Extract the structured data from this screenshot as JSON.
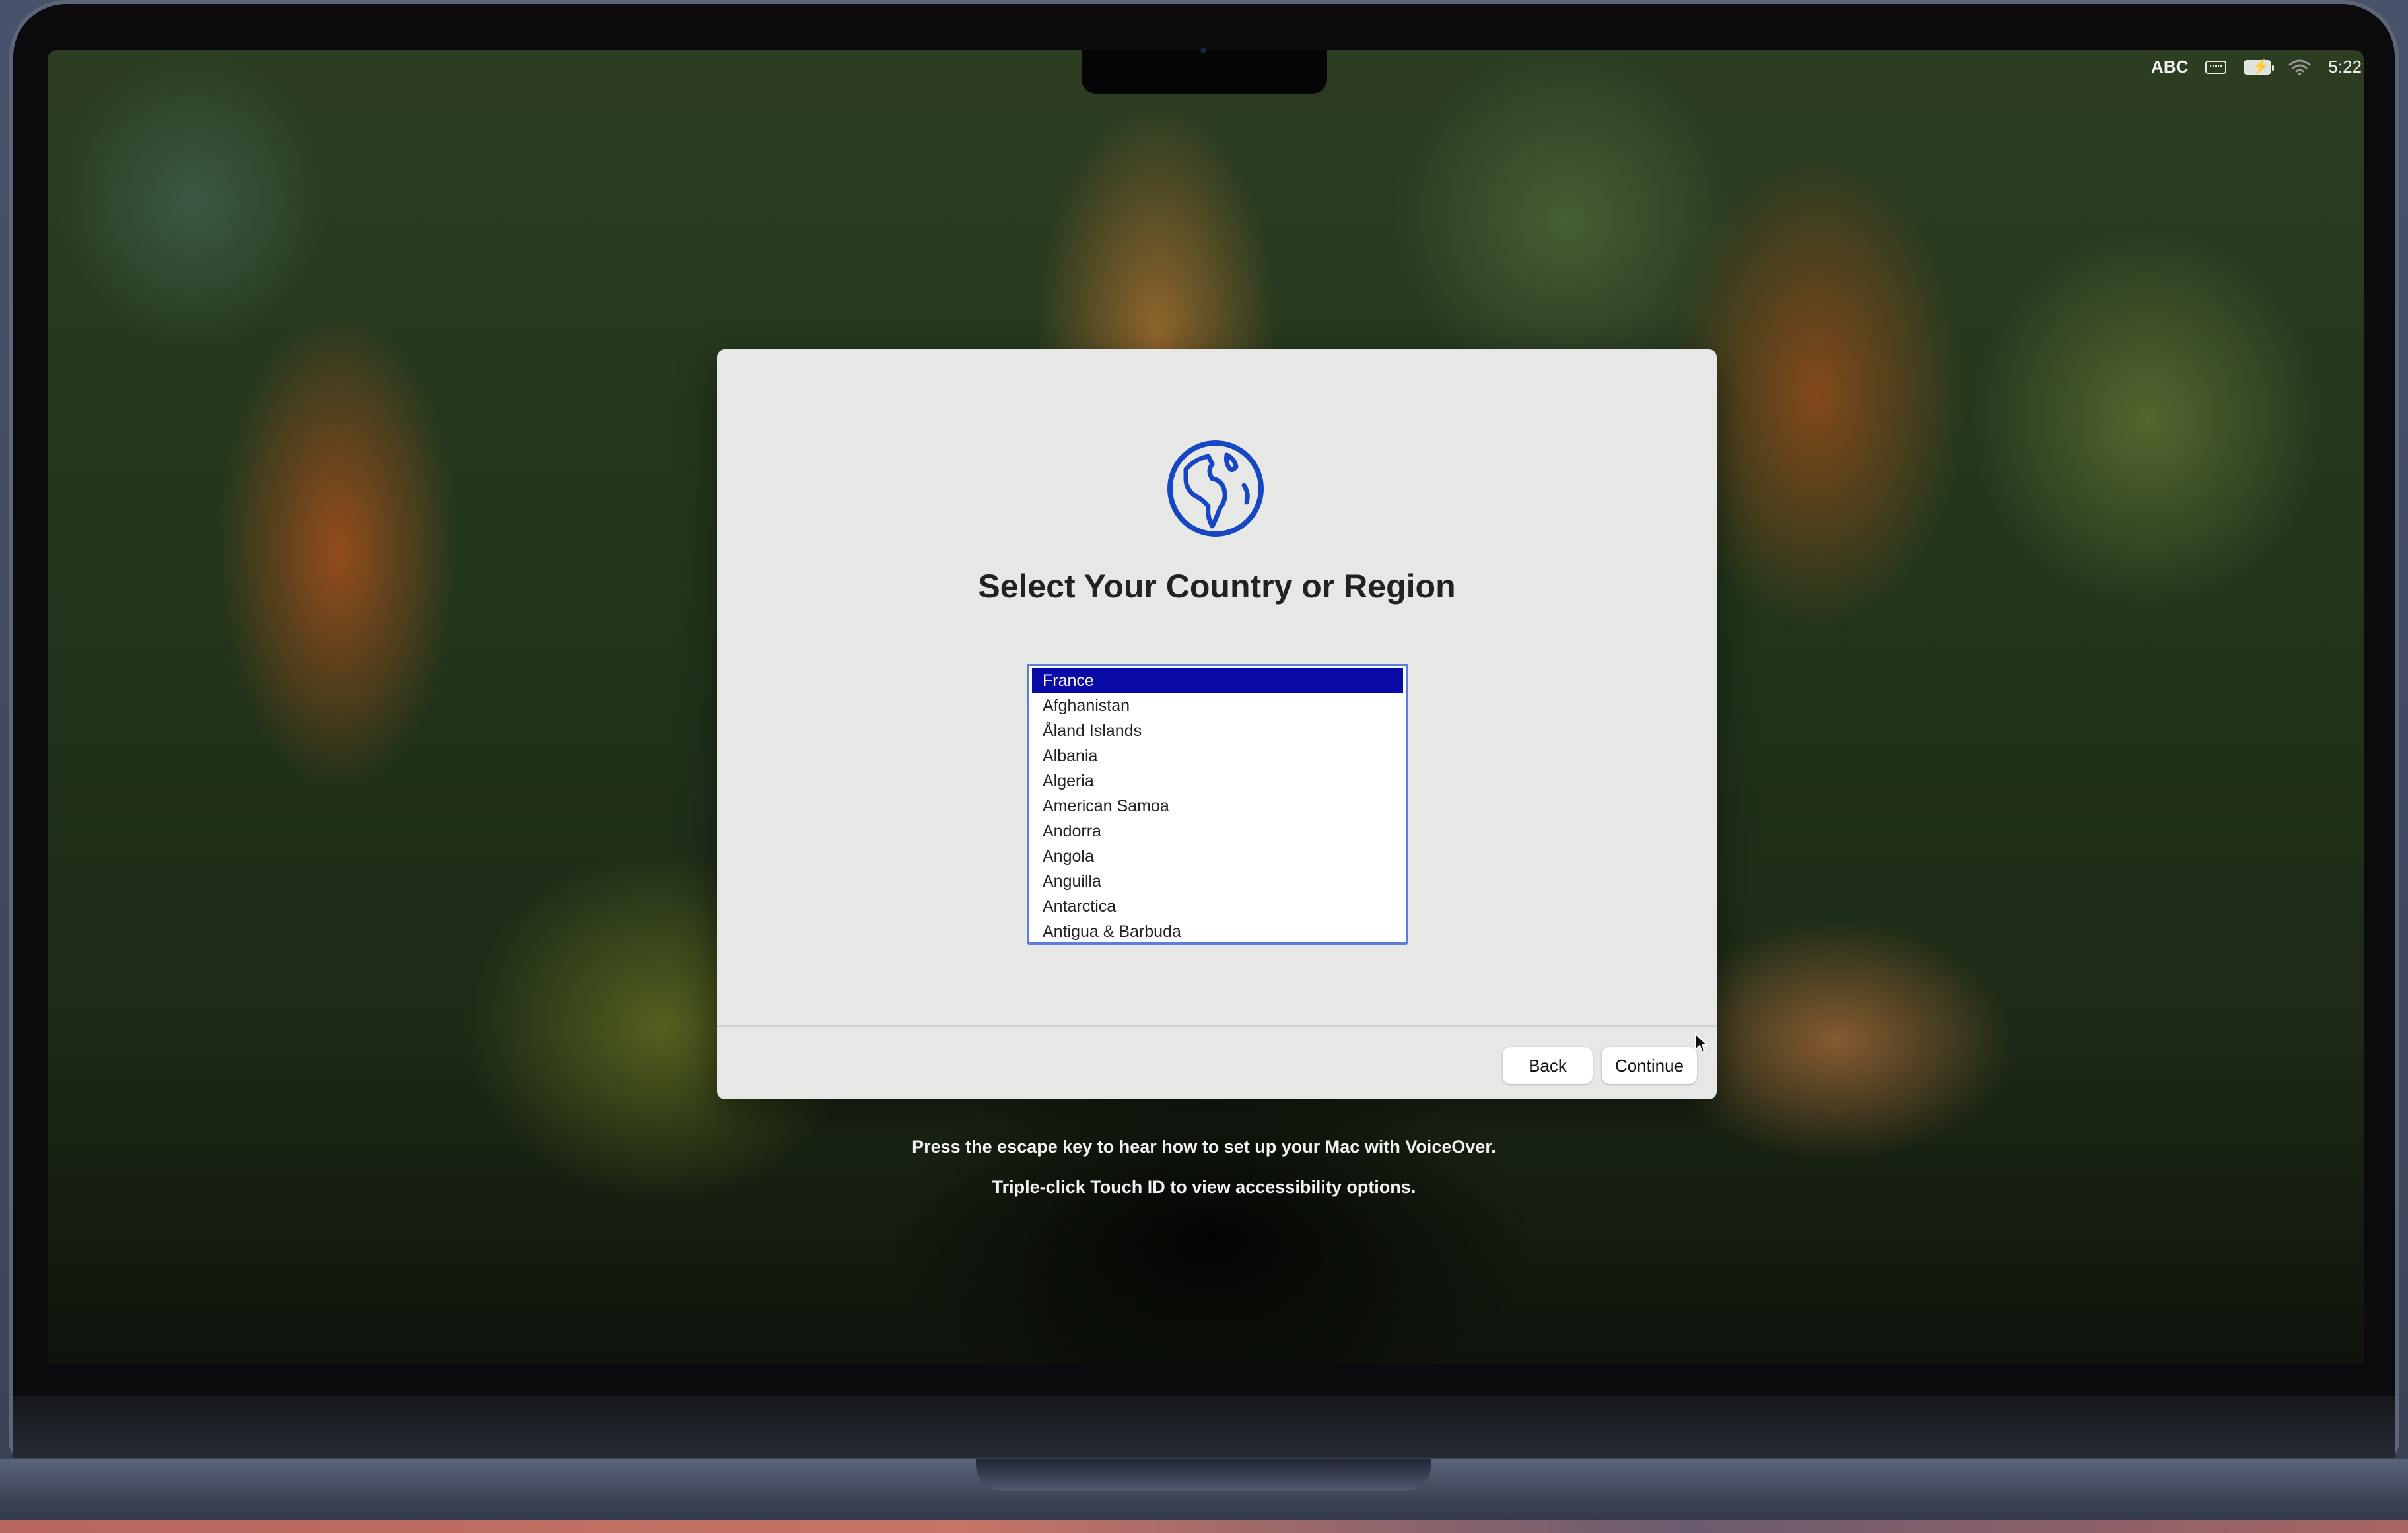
{
  "menu_bar": {
    "input_source": "ABC",
    "clock": "5:22"
  },
  "setup": {
    "title": "Select Your Country or Region",
    "countries": [
      {
        "label": "France",
        "selected": true
      },
      {
        "label": "Afghanistan",
        "selected": false
      },
      {
        "label": "Åland Islands",
        "selected": false
      },
      {
        "label": "Albania",
        "selected": false
      },
      {
        "label": "Algeria",
        "selected": false
      },
      {
        "label": "American Samoa",
        "selected": false
      },
      {
        "label": "Andorra",
        "selected": false
      },
      {
        "label": "Angola",
        "selected": false
      },
      {
        "label": "Anguilla",
        "selected": false
      },
      {
        "label": "Antarctica",
        "selected": false
      },
      {
        "label": "Antigua & Barbuda",
        "selected": false
      }
    ],
    "back_label": "Back",
    "continue_label": "Continue"
  },
  "hints": {
    "voiceover": "Press the escape key to hear how to set up your Mac with VoiceOver.",
    "accessibility": "Triple-click Touch ID to view accessibility options."
  },
  "colors": {
    "selection": "#0a0aa6",
    "list_focus_ring": "#5b7fd8",
    "globe": "#1746c4"
  },
  "icons": {
    "globe": "globe-icon",
    "keyboard": "keyboard-icon",
    "battery": "battery-charging-icon",
    "wifi": "wifi-icon",
    "pointer": "pointer-cursor-icon"
  }
}
